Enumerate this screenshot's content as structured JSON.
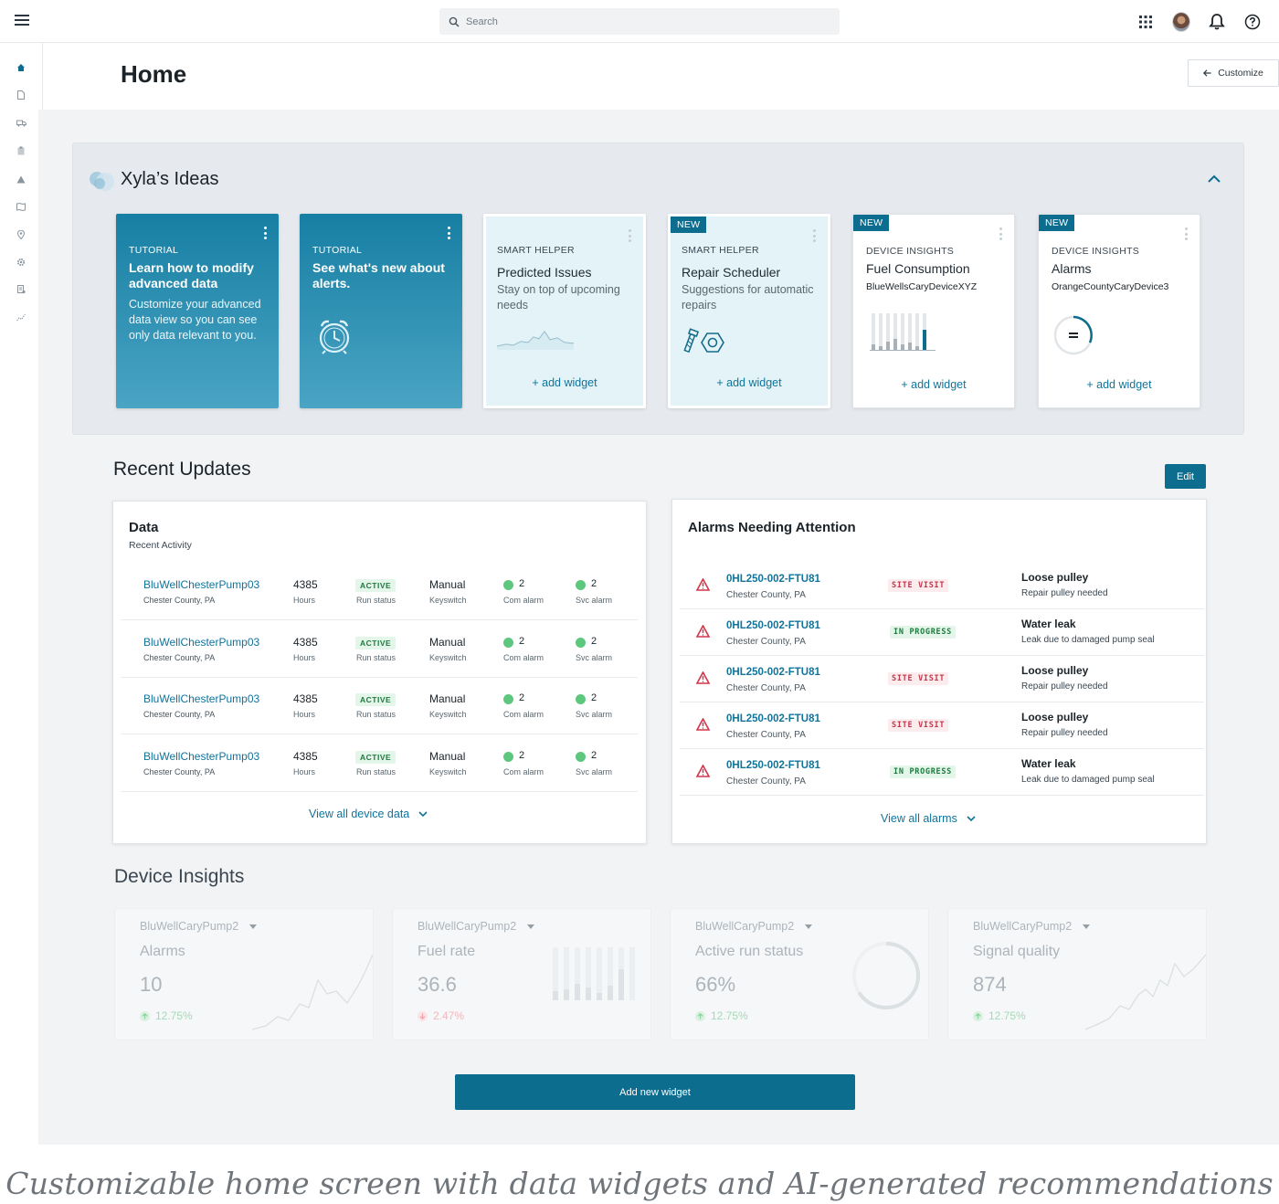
{
  "topbar": {
    "search_placeholder": "Search",
    "icons": [
      "menu-icon",
      "search-icon",
      "apps-grid-icon",
      "user-avatar",
      "bell-icon",
      "help-icon"
    ]
  },
  "sidebar": {
    "icons": [
      "home-icon",
      "document-icon",
      "truck-icon",
      "clipboard-icon",
      "warning-icon",
      "map-icon",
      "location-icon",
      "settings-icon",
      "report-icon",
      "analytics-icon"
    ],
    "active": "home-icon",
    "accent": "#0d6d8f"
  },
  "header": {
    "title": "Home",
    "customize_label": "Customize"
  },
  "ideas": {
    "title": "Xyla’s Ideas",
    "cards": [
      {
        "type": "tutorial",
        "category": "TUTORIAL",
        "title": "Learn how to modify advanced data",
        "description": "Customize your advanced data view so you can see only data relevant to you."
      },
      {
        "type": "tutorial",
        "category": "TUTORIAL",
        "title": "See what's new about alerts.",
        "art": "alarm-clock-icon"
      },
      {
        "type": "helper",
        "category": "SMART HELPER",
        "title": "Predicted Issues",
        "description": "Stay on top of upcoming needs",
        "action": "+ add widget",
        "art": "mountain-line-chart"
      },
      {
        "type": "helper",
        "badge": "NEW",
        "category": "SMART HELPER",
        "title": "Repair Scheduler",
        "description": "Suggestions for automatic repairs",
        "action": "+ add widget",
        "art": "bolt-nut-icon"
      },
      {
        "type": "device",
        "badge": "NEW",
        "category": "DEVICE INSIGHTS",
        "title": "Fuel Consumption",
        "subtitle": "BlueWellsCaryDeviceXYZ",
        "action": "+ add widget",
        "art": "bar-chart"
      },
      {
        "type": "device",
        "badge": "NEW",
        "category": "DEVICE INSIGHTS",
        "title": "Alarms",
        "subtitle": "OrangeCountyCaryDevice3",
        "action": "+ add widget",
        "art": "gauge-icon"
      }
    ]
  },
  "recent": {
    "title": "Recent Updates",
    "edit_label": "Edit",
    "data_panel": {
      "title": "Data",
      "subtitle": "Recent Activity",
      "rows": [
        {
          "name": "BluWellChesterPump03",
          "location": "Chester County, PA",
          "hours": "4385",
          "hours_label": "Hours",
          "status": "ACTIVE",
          "status_label": "Run status",
          "mode": "Manual",
          "mode_label": "Keyswitch",
          "com": "2",
          "com_label": "Com alarm",
          "svc": "2",
          "svc_label": "Svc alarm"
        },
        {
          "name": "BluWellChesterPump03",
          "location": "Chester County, PA",
          "hours": "4385",
          "hours_label": "Hours",
          "status": "ACTIVE",
          "status_label": "Run status",
          "mode": "Manual",
          "mode_label": "Keyswitch",
          "com": "2",
          "com_label": "Com alarm",
          "svc": "2",
          "svc_label": "Svc alarm"
        },
        {
          "name": "BluWellChesterPump03",
          "location": "Chester County, PA",
          "hours": "4385",
          "hours_label": "Hours",
          "status": "ACTIVE",
          "status_label": "Run status",
          "mode": "Manual",
          "mode_label": "Keyswitch",
          "com": "2",
          "com_label": "Com alarm",
          "svc": "2",
          "svc_label": "Svc alarm"
        },
        {
          "name": "BluWellChesterPump03",
          "location": "Chester County, PA",
          "hours": "4385",
          "hours_label": "Hours",
          "status": "ACTIVE",
          "status_label": "Run status",
          "mode": "Manual",
          "mode_label": "Keyswitch",
          "com": "2",
          "com_label": "Com alarm",
          "svc": "2",
          "svc_label": "Svc alarm"
        }
      ],
      "view_all": "View all device data"
    },
    "alarms_panel": {
      "title": "Alarms Needing Attention",
      "rows": [
        {
          "id": "0HL250-002-FTU81",
          "location": "Chester County, PA",
          "status": "SITE VISIT",
          "kind": "site",
          "issue": "Loose pulley",
          "detail": "Repair pulley needed"
        },
        {
          "id": "0HL250-002-FTU81",
          "location": "Chester County, PA",
          "status": "IN PROGRESS",
          "kind": "prog",
          "issue": "Water leak",
          "detail": "Leak due to damaged pump seal"
        },
        {
          "id": "0HL250-002-FTU81",
          "location": "Chester County, PA",
          "status": "SITE VISIT",
          "kind": "site",
          "issue": "Loose pulley",
          "detail": "Repair pulley needed"
        },
        {
          "id": "0HL250-002-FTU81",
          "location": "Chester County, PA",
          "status": "SITE VISIT",
          "kind": "site",
          "issue": "Loose pulley",
          "detail": "Repair pulley needed"
        },
        {
          "id": "0HL250-002-FTU81",
          "location": "Chester County, PA",
          "status": "IN PROGRESS",
          "kind": "prog",
          "issue": "Water leak",
          "detail": "Leak due to damaged pump seal"
        }
      ],
      "view_all": "View all alarms"
    }
  },
  "insights": {
    "title": "Device Insights",
    "widgets": [
      {
        "device": "BluWellCaryPump2",
        "metric": "Alarms",
        "value": "10",
        "change": "12.75%",
        "direction": "up",
        "art": "line-sparkline"
      },
      {
        "device": "BluWellCaryPump2",
        "metric": "Fuel rate",
        "value": "36.6",
        "change": "2.47%",
        "direction": "down",
        "art": "bar-sparkline"
      },
      {
        "device": "BluWellCaryPump2",
        "metric": "Active run status",
        "value": "66%",
        "change": "12.75%",
        "direction": "up",
        "art": "ring-gauge",
        "gauge_fraction": 0.66
      },
      {
        "device": "BluWellCaryPump2",
        "metric": "Signal quality",
        "value": "874",
        "change": "12.75%",
        "direction": "up",
        "art": "line-sparkline"
      }
    ]
  },
  "add_widget_label": "Add new widget",
  "caption": "Customizable home screen with data widgets and AI-generated recommendations"
}
